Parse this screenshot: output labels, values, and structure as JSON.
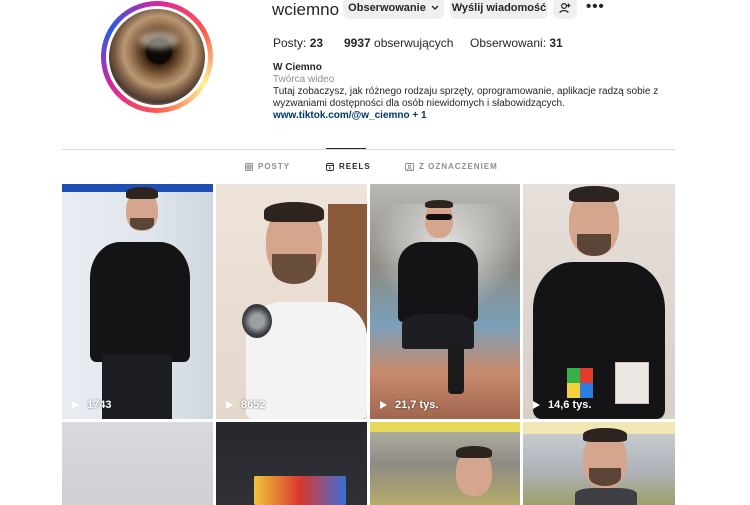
{
  "profile": {
    "username": "wciemno",
    "follow_label": "Obserwowanie",
    "message_label": "Wyślij wiadomość",
    "stats": [
      {
        "label": "Posty:",
        "value": "23"
      },
      {
        "label": "obserwujących",
        "value": "9937"
      },
      {
        "label": "Obserwowani:",
        "value": "31"
      }
    ],
    "bio_name": "W Ciemno",
    "bio_category": "Twórca wideo",
    "bio_text": "Tutaj zobaczysz, jak różnego rodzaju sprzęty, oprogramowanie, aplikacje radzą sobie z wyzwaniami dostępności dla osób niewidomych i słabowidzących.",
    "bio_link": "www.tiktok.com/@w_ciemno + 1"
  },
  "tabs": [
    {
      "label": "POSTY",
      "icon": "grid-icon",
      "active": false
    },
    {
      "label": "REELS",
      "icon": "reels-icon",
      "active": true
    },
    {
      "label": "Z OZNACZENIEM",
      "icon": "tagged-icon",
      "active": false
    }
  ],
  "reels": [
    {
      "views": "1743"
    },
    {
      "views": "8652"
    },
    {
      "views": "21,7 tys."
    },
    {
      "views": "14,6 tys."
    }
  ],
  "colors": {
    "link": "#00376b",
    "secondary_text": "#8e8e8e",
    "button_bg": "#efefef",
    "divider": "#dbdbdb"
  }
}
